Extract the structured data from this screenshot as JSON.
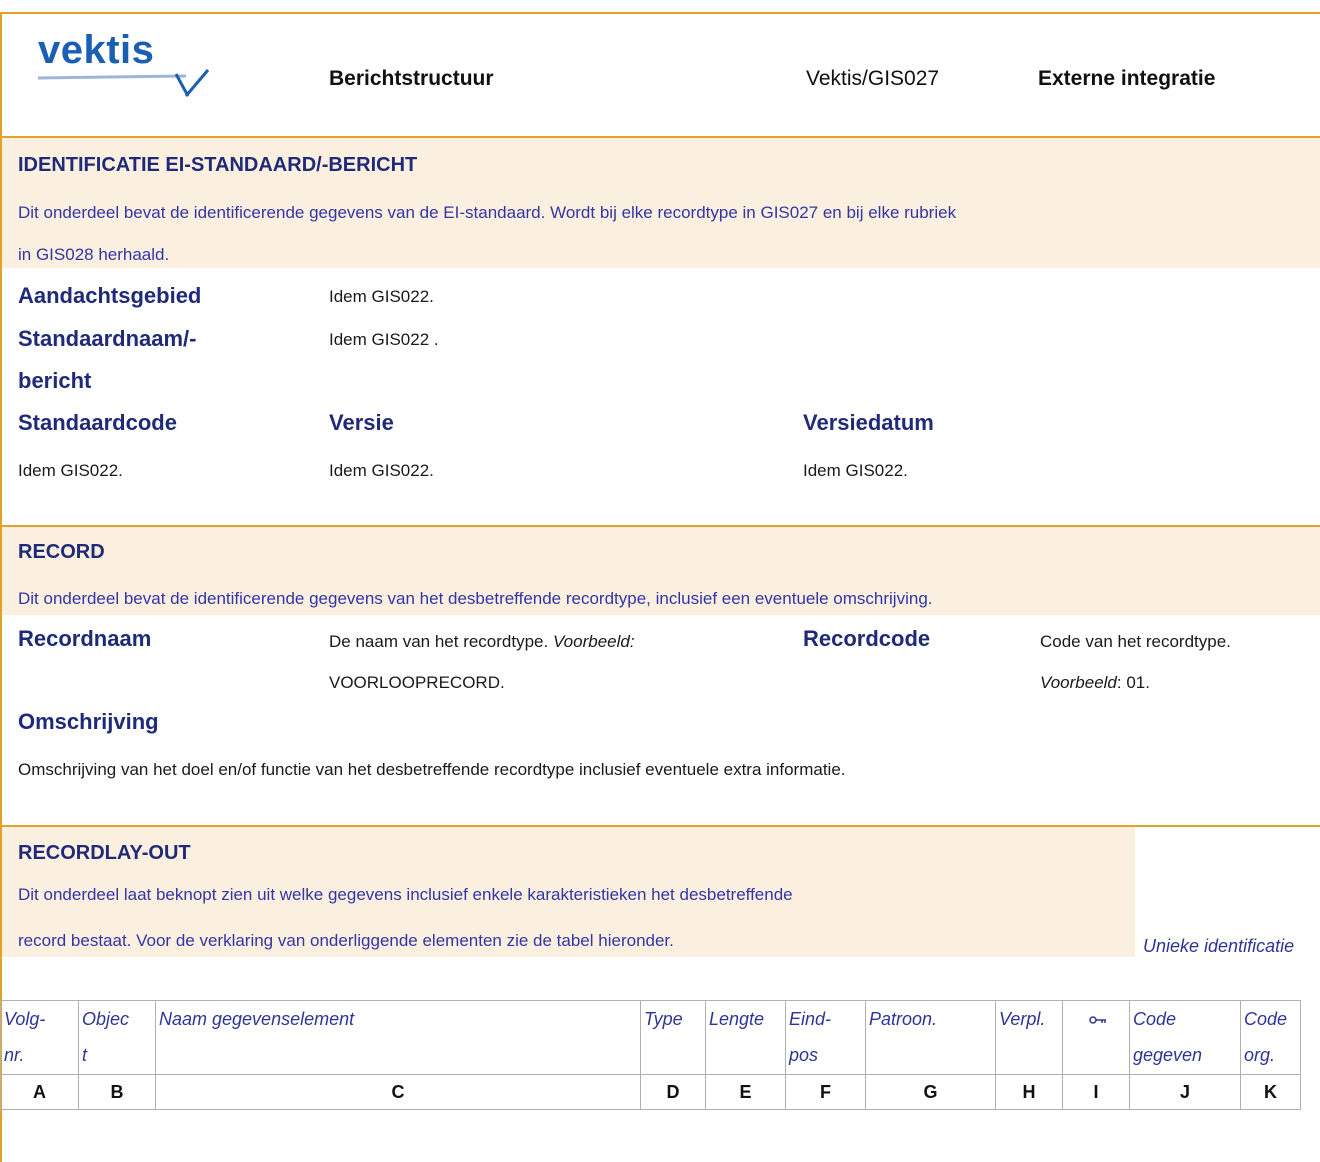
{
  "header": {
    "logo_text": "vektis",
    "title": "Berichtstructuur",
    "code": "Vektis/GIS027",
    "category": "Externe integratie"
  },
  "identificatie": {
    "title": "IDENTIFICATIE EI-STANDAARD/-BERICHT",
    "desc_line1": "Dit onderdeel bevat de identificerende gegevens van de EI-standaard. Wordt bij elke recordtype in GIS027 en bij elke rubriek",
    "desc_line2": "in GIS028 herhaald.",
    "aandachtsgebied_label": "Aandachtsgebied",
    "aandachtsgebied_value": "Idem GIS022.",
    "standaardnaam_label_1": "Standaardnaam/-",
    "standaardnaam_label_2": "bericht",
    "standaardnaam_value": "Idem GIS022 .",
    "standaardcode_label": "Standaardcode",
    "standaardcode_value": "Idem GIS022.",
    "versie_label": "Versie",
    "versie_value": "Idem GIS022.",
    "versiedatum_label": "Versiedatum",
    "versiedatum_value": "Idem GIS022."
  },
  "record": {
    "title": "RECORD",
    "desc": "Dit onderdeel bevat de identificerende gegevens van het desbetreffende recordtype, inclusief een eventuele omschrijving.",
    "recordnaam_label": "Recordnaam",
    "recordnaam_value_1": "De naam van het recordtype.",
    "recordnaam_value_ex": "Voorbeeld:",
    "recordnaam_value_2": "VOORLOOPRECORD.",
    "recordcode_label": "Recordcode",
    "recordcode_value_1": "Code van het recordtype.",
    "recordcode_value_ex": "Voorbeeld",
    "recordcode_value_2": ": 01.",
    "omschrijving_label": "Omschrijving",
    "omschrijving_value": "Omschrijving van het doel en/of functie van het desbetreffende recordtype inclusief eventuele extra informatie."
  },
  "recordlayout": {
    "title": "RECORDLAY-OUT",
    "desc_line1": "Dit onderdeel laat beknopt zien uit welke gegevens inclusief enkele karakteristieken het desbetreffende",
    "desc_line2": "record bestaat. Voor de verklaring van onderliggende elementen zie de tabel hieronder.",
    "unique_label": "Unieke identificatie"
  },
  "table": {
    "headers": [
      "Volg-nr.",
      "Object",
      "Naam gegevenselement",
      "Type",
      "Lengte",
      "Eind-pos",
      "Patroon.",
      "Verpl.",
      "key-icon",
      "Code gegeven",
      "Code org."
    ],
    "letters": [
      "A",
      "B",
      "C",
      "D",
      "E",
      "F",
      "G",
      "H",
      "I",
      "J",
      "K"
    ]
  }
}
